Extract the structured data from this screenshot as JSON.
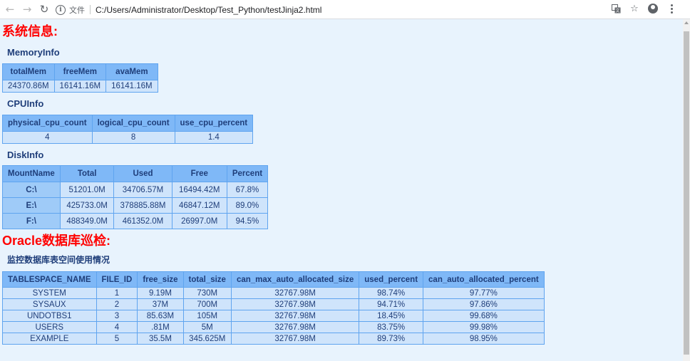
{
  "browser": {
    "protocol_label": "文件",
    "url": "C:/Users/Administrator/Desktop/Test_Python/testJinja2.html"
  },
  "sections": {
    "system_title": "系统信息:",
    "oracle_title": "Oracle数据库巡检:"
  },
  "memory": {
    "title": "MemoryInfo",
    "headers": [
      "totalMem",
      "freeMem",
      "avaMem"
    ],
    "row": [
      "24370.86M",
      "16141.16M",
      "16141.16M"
    ]
  },
  "cpu": {
    "title": "CPUInfo",
    "headers": [
      "physical_cpu_count",
      "logical_cpu_count",
      "use_cpu_percent"
    ],
    "row": [
      "4",
      "8",
      "1.4"
    ]
  },
  "disk": {
    "title": "DiskInfo",
    "headers": [
      "MountName",
      "Total",
      "Used",
      "Free",
      "Percent"
    ],
    "rows": [
      [
        "C:\\",
        "51201.0M",
        "34706.57M",
        "16494.42M",
        "67.8%"
      ],
      [
        "E:\\",
        "425733.0M",
        "378885.88M",
        "46847.12M",
        "89.0%"
      ],
      [
        "F:\\",
        "488349.0M",
        "461352.0M",
        "26997.0M",
        "94.5%"
      ]
    ]
  },
  "tablespace": {
    "title": "监控数据库表空间使用情况",
    "headers": [
      "TABLESPACE_NAME",
      "FILE_ID",
      "free_size",
      "total_size",
      "can_max_auto_allocated_size",
      "used_percent",
      "can_auto_allocated_percent"
    ],
    "rows": [
      [
        "SYSTEM",
        "1",
        "9.19M",
        "730M",
        "32767.98M",
        "98.74%",
        "97.77%"
      ],
      [
        "SYSAUX",
        "2",
        "37M",
        "700M",
        "32767.98M",
        "94.71%",
        "97.86%"
      ],
      [
        "UNDOTBS1",
        "3",
        "85.63M",
        "105M",
        "32767.98M",
        "18.45%",
        "99.68%"
      ],
      [
        "USERS",
        "4",
        ".81M",
        "5M",
        "32767.98M",
        "83.75%",
        "99.98%"
      ],
      [
        "EXAMPLE",
        "5",
        "35.5M",
        "345.625M",
        "32767.98M",
        "89.73%",
        "98.95%"
      ]
    ]
  }
}
